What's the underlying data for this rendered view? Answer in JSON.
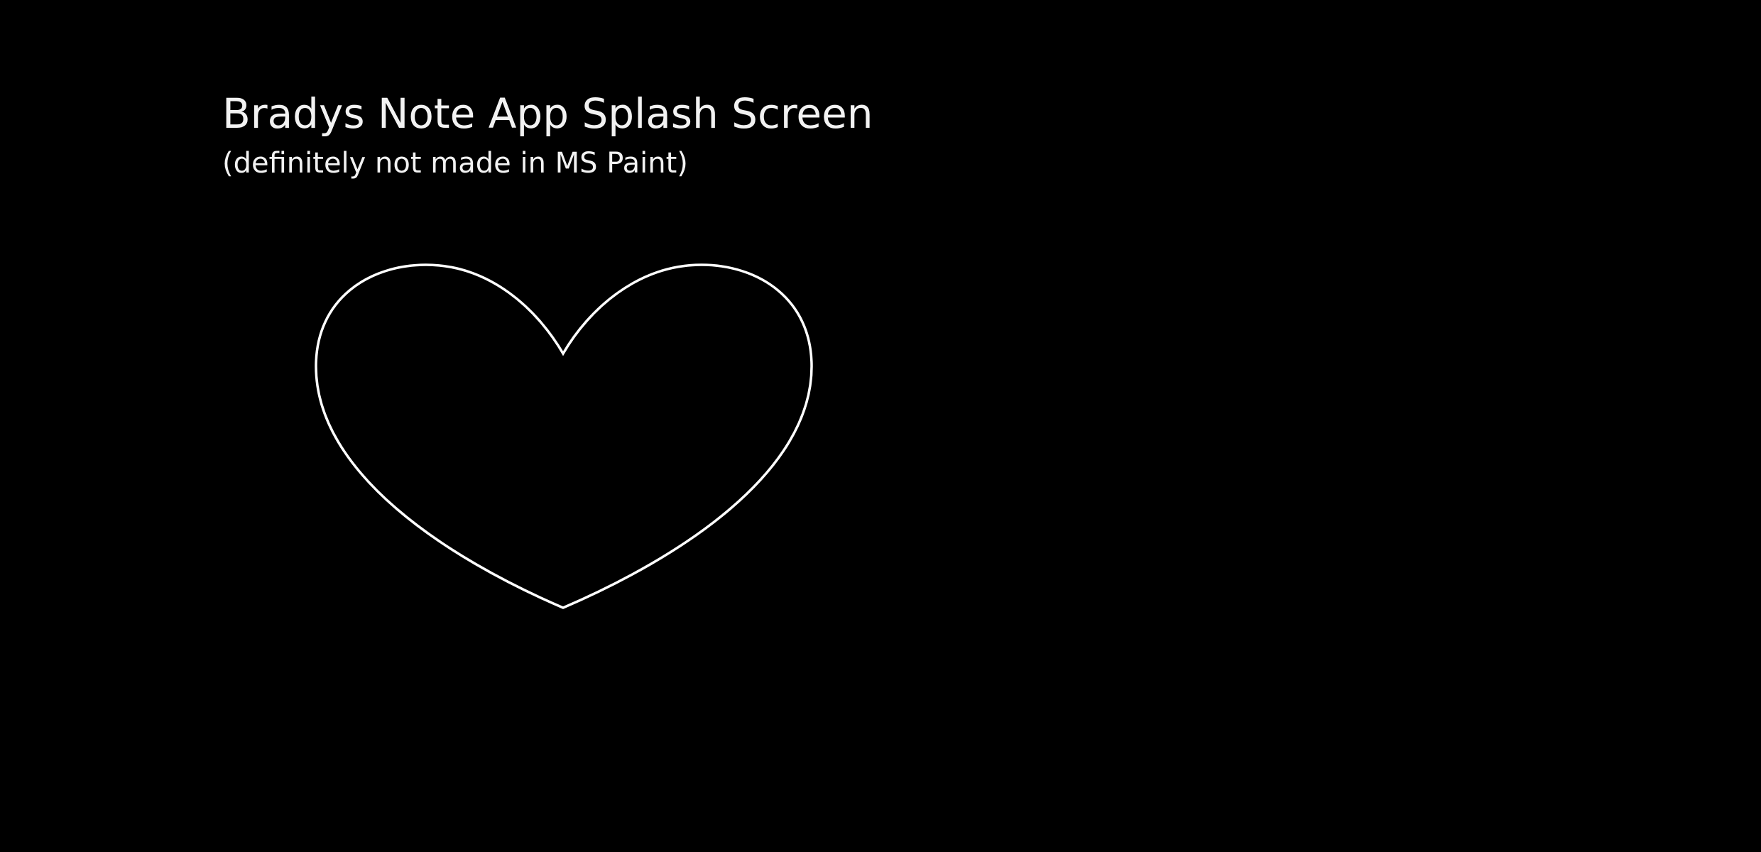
{
  "splash": {
    "title": "Bradys Note App Splash Screen",
    "subtitle": "(definitely not made in MS Paint)",
    "background_color": "#000000",
    "text_color": "#f2f2f2",
    "graphic": {
      "icon": "heart-outline-icon",
      "stroke_color": "#ffffff"
    }
  }
}
